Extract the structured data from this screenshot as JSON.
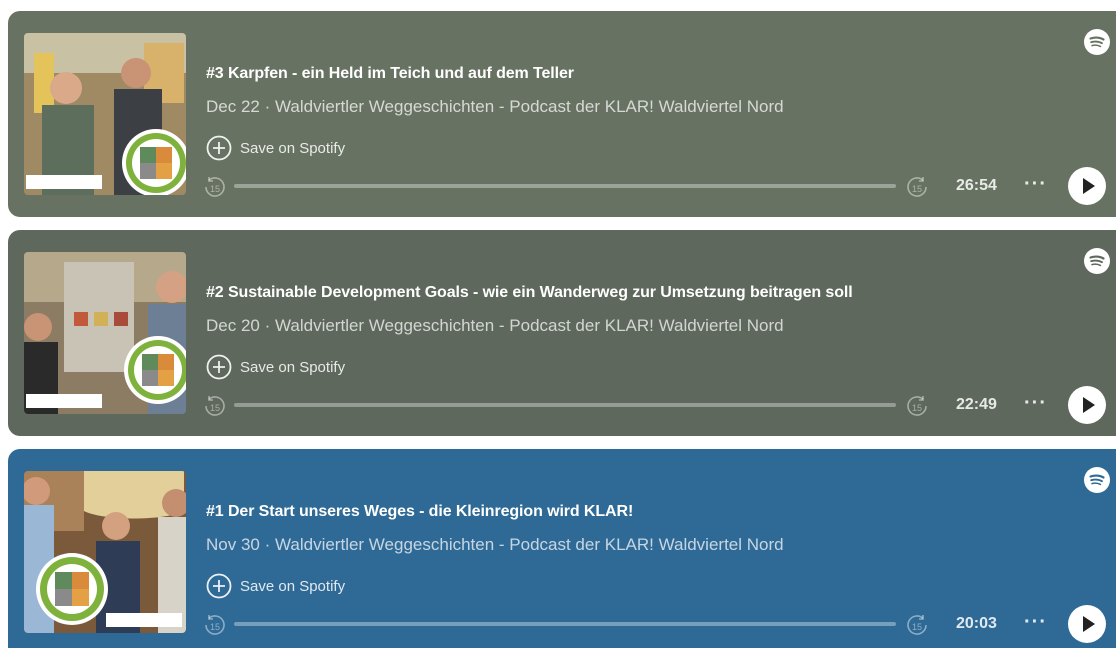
{
  "episodes": [
    {
      "title": "#3 Karpfen - ein Held im Teich und auf dem Teller",
      "meta": "Dec 22 · Waldviertler Weggeschichten - Podcast der KLAR! Waldviertel Nord",
      "save_label": "Save on Spotify",
      "duration": "26:54",
      "more_label": "···",
      "progress": 0,
      "background": "#687262"
    },
    {
      "title": "#2 Sustainable Development Goals - wie ein Wanderweg zur Umsetzung beitragen soll",
      "meta": "Dec 20 · Waldviertler Weggeschichten - Podcast der KLAR! Waldviertel Nord",
      "save_label": "Save on Spotify",
      "duration": "22:49",
      "more_label": "···",
      "progress": 0,
      "background": "#5f685d"
    },
    {
      "title": "#1 Der Start unseres Weges - die Kleinregion wird KLAR!",
      "meta": "Nov 30 · Waldviertler Weggeschichten - Podcast der KLAR! Waldviertel Nord",
      "save_label": "Save on Spotify",
      "duration": "20:03",
      "more_label": "···",
      "progress": 0,
      "background": "#2f6a96"
    }
  ],
  "icons": {
    "brand": "spotify-icon",
    "save": "plus-circle-icon",
    "skip_back": "skip-back-15-icon",
    "skip_forward": "skip-forward-15-icon",
    "play": "play-icon"
  },
  "skip_seconds": "15",
  "badge_text": "WALDVIERTLER WEGGESCHICHTEN"
}
